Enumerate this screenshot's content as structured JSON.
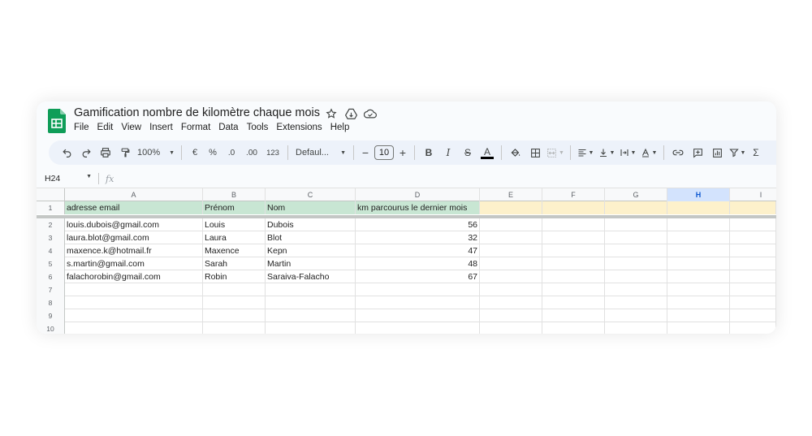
{
  "app": {
    "title": "Gamification nombre de kilomètre chaque mois",
    "menu": [
      "File",
      "Edit",
      "View",
      "Insert",
      "Format",
      "Data",
      "Tools",
      "Extensions",
      "Help"
    ]
  },
  "toolbar": {
    "zoom": "100%",
    "currency": "€",
    "percent": "%",
    "decrease_decimal": ".0",
    "increase_decimal": ".00",
    "number_format": "123",
    "font": "Defaul...",
    "font_size": "10",
    "minus": "−",
    "plus": "+",
    "bold": "B",
    "italic": "I",
    "strike": "S",
    "text_color": "A",
    "sum": "Σ"
  },
  "formula_bar": {
    "cell_ref": "H24",
    "fx": "fx"
  },
  "sheet": {
    "columns": [
      "A",
      "B",
      "C",
      "D",
      "E",
      "F",
      "G",
      "H",
      "I"
    ],
    "selected_column": "H",
    "rows": [
      {
        "num": "1",
        "cells": [
          "adresse email",
          "Prénom",
          "Nom",
          "km parcourus le dernier mois"
        ]
      },
      {
        "num": "2",
        "cells": [
          "louis.dubois@gmail.com",
          "Louis",
          "Dubois",
          "56"
        ]
      },
      {
        "num": "3",
        "cells": [
          "laura.blot@gmail.com",
          "Laura",
          "Blot",
          "32"
        ]
      },
      {
        "num": "4",
        "cells": [
          "maxence.k@hotmail.fr",
          "Maxence",
          "Kepn",
          "47"
        ]
      },
      {
        "num": "5",
        "cells": [
          "s.martin@gmail.com",
          "Sarah",
          "Martin",
          "48"
        ]
      },
      {
        "num": "6",
        "cells": [
          "falachorobin@gmail.com",
          "Robin",
          "Saraiva-Falacho",
          "67"
        ]
      },
      {
        "num": "7",
        "cells": [
          "",
          "",
          "",
          ""
        ]
      },
      {
        "num": "8",
        "cells": [
          "",
          "",
          "",
          ""
        ]
      },
      {
        "num": "9",
        "cells": [
          "",
          "",
          "",
          ""
        ]
      },
      {
        "num": "10",
        "cells": [
          "",
          "",
          "",
          ""
        ]
      }
    ]
  },
  "colors": {
    "header_green": "#c8e6d3",
    "header_yellow": "#fdf1cb",
    "selection": "#d3e3fd",
    "toolbar_bg": "#edf2fa"
  }
}
